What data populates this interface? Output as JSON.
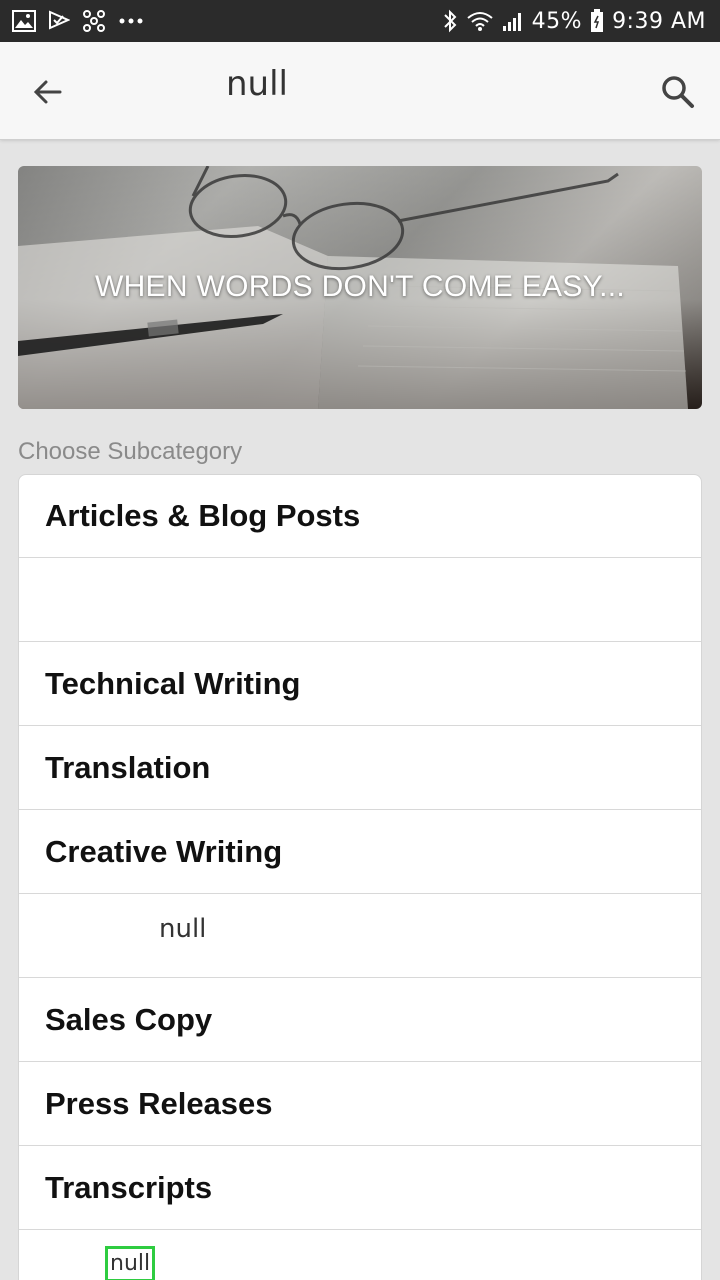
{
  "status_bar": {
    "icons_left": [
      "gallery-icon",
      "check-flag-icon",
      "sync-icon",
      "more-dots-icon"
    ],
    "battery": "45%",
    "time": "9:39 AM"
  },
  "app_bar": {
    "title": "null"
  },
  "hero": {
    "title": "WHEN WORDS DON'T COME EASY..."
  },
  "subcategory": {
    "label": "Choose Subcategory",
    "items": [
      {
        "label": "Articles & Blog Posts"
      },
      {
        "label": ""
      },
      {
        "label": "Technical Writing"
      },
      {
        "label": "Translation"
      },
      {
        "label": "Creative Writing"
      },
      {
        "label": "",
        "overlay": "null"
      },
      {
        "label": "Sales Copy"
      },
      {
        "label": "Press Releases"
      },
      {
        "label": "Transcripts"
      },
      {
        "label": "",
        "overlay": "null"
      }
    ]
  },
  "colors": {
    "status_bar_bg": "#2b2b2b",
    "app_bar_bg": "#f7f7f7",
    "page_bg": "#e4e4e4",
    "highlight": "#2ecc40"
  }
}
